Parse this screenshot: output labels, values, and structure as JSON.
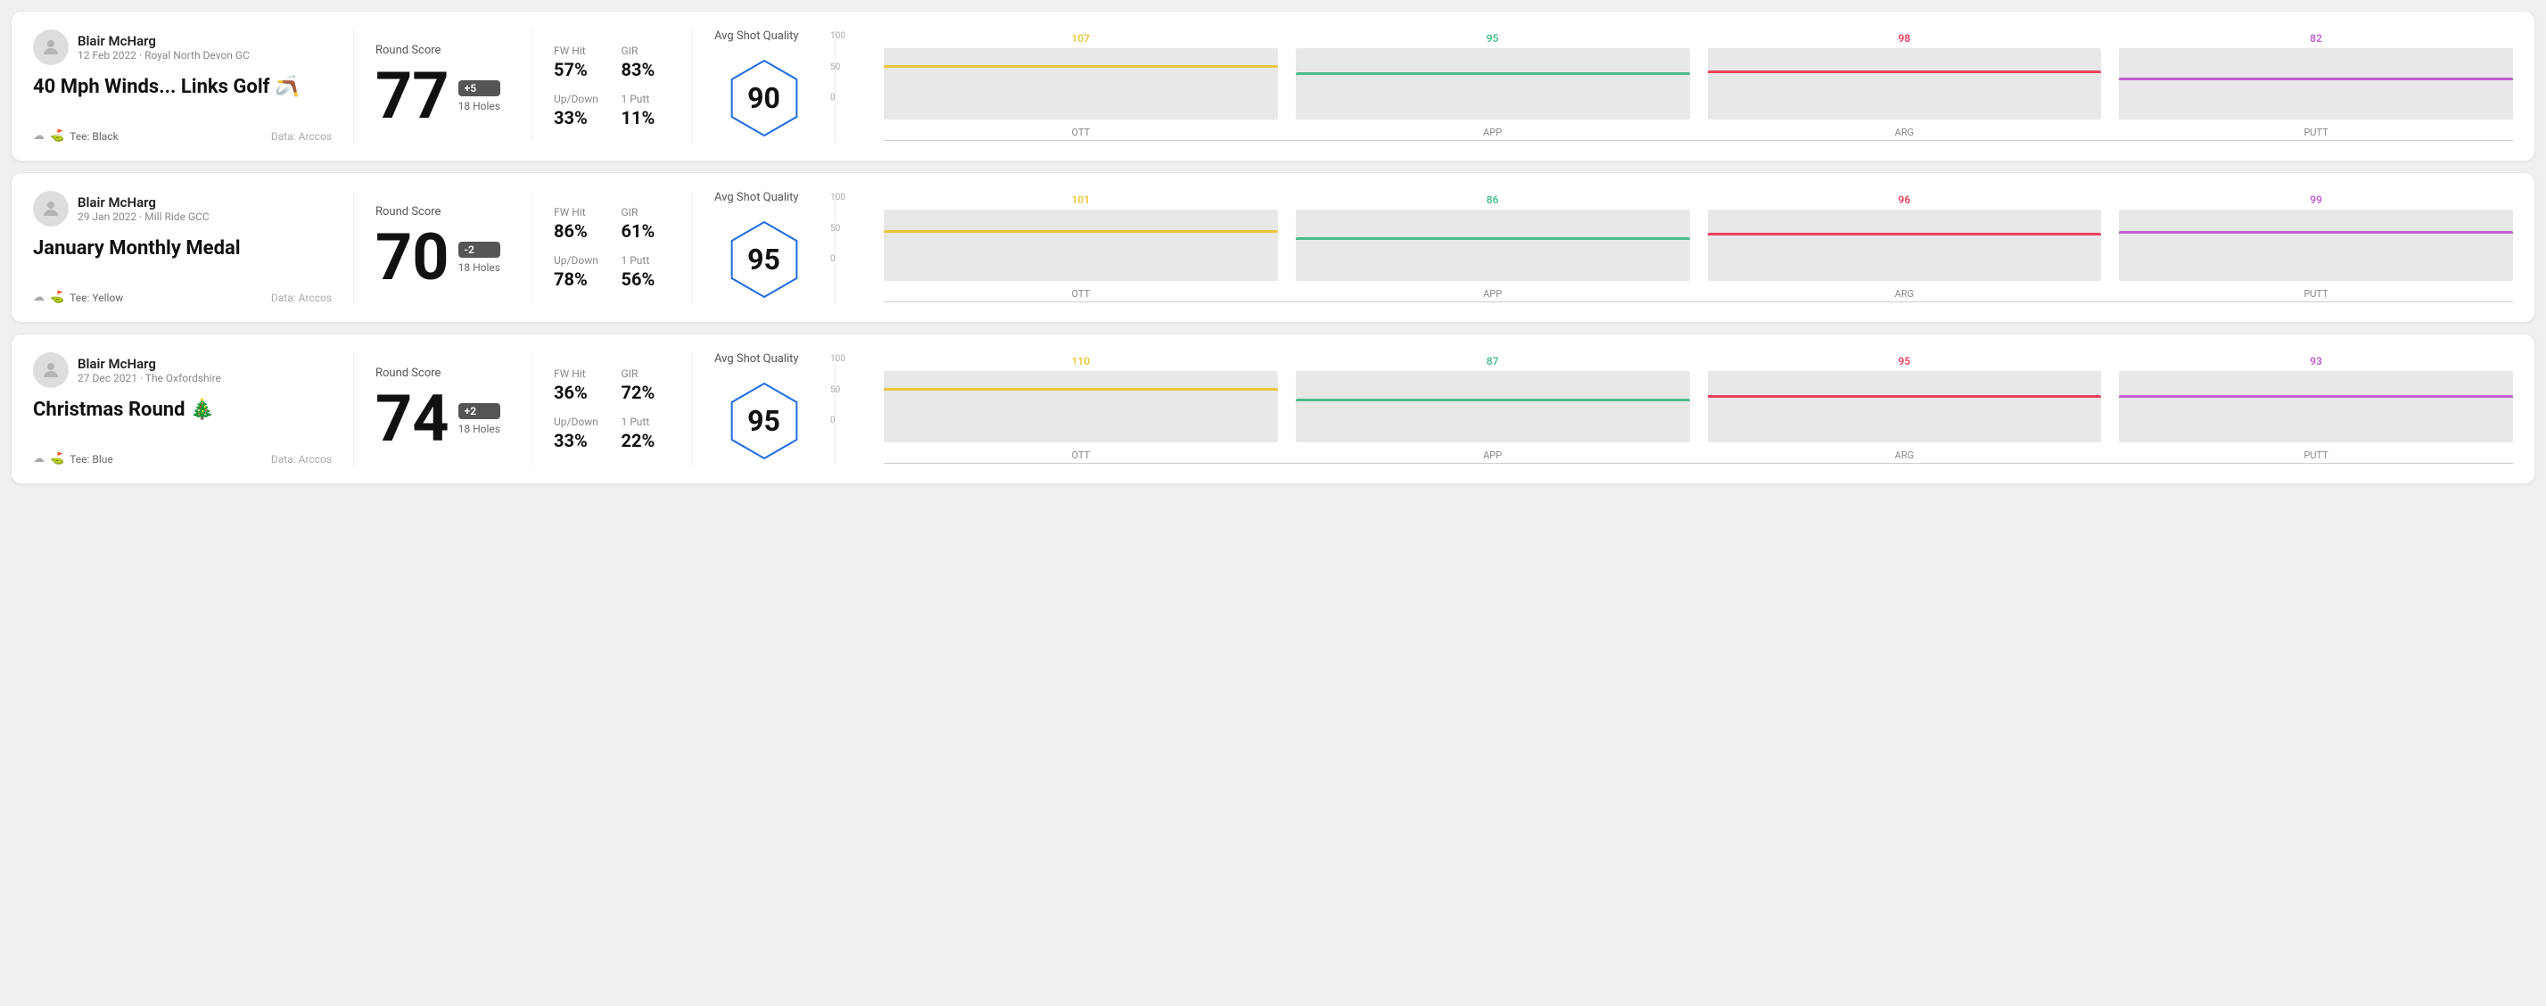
{
  "cards": [
    {
      "id": "card-1",
      "user": {
        "name": "Blair McHarg",
        "meta": "12 Feb 2022 · Royal North Devon GC"
      },
      "title": "40 Mph Winds... Links Golf 🪃",
      "tee": "Black",
      "data_source": "Data: Arccos",
      "round_score_label": "Round Score",
      "score": "77",
      "badge": "+5",
      "holes": "18 Holes",
      "stats": [
        {
          "label": "FW Hit",
          "value": "57%"
        },
        {
          "label": "GIR",
          "value": "83%"
        },
        {
          "label": "Up/Down",
          "value": "33%"
        },
        {
          "label": "1 Putt",
          "value": "11%"
        }
      ],
      "avg_shot_label": "Avg Shot Quality",
      "quality_score": "90",
      "bars": [
        {
          "label": "OTT",
          "value": 107,
          "color": "#e8c840",
          "pct": 72
        },
        {
          "label": "APP",
          "value": 95,
          "color": "#4cbe8c",
          "pct": 63
        },
        {
          "label": "ARG",
          "value": 98,
          "color": "#e84060",
          "pct": 65
        },
        {
          "label": "PUTT",
          "value": 82,
          "color": "#c060d0",
          "pct": 55
        }
      ]
    },
    {
      "id": "card-2",
      "user": {
        "name": "Blair McHarg",
        "meta": "29 Jan 2022 · Mill Ride GCC"
      },
      "title": "January Monthly Medal",
      "tee": "Yellow",
      "data_source": "Data: Arccos",
      "round_score_label": "Round Score",
      "score": "70",
      "badge": "-2",
      "holes": "18 Holes",
      "stats": [
        {
          "label": "FW Hit",
          "value": "86%"
        },
        {
          "label": "GIR",
          "value": "61%"
        },
        {
          "label": "Up/Down",
          "value": "78%"
        },
        {
          "label": "1 Putt",
          "value": "56%"
        }
      ],
      "avg_shot_label": "Avg Shot Quality",
      "quality_score": "95",
      "bars": [
        {
          "label": "OTT",
          "value": 101,
          "color": "#e8c840",
          "pct": 67
        },
        {
          "label": "APP",
          "value": 86,
          "color": "#4cbe8c",
          "pct": 57
        },
        {
          "label": "ARG",
          "value": 96,
          "color": "#e84060",
          "pct": 64
        },
        {
          "label": "PUTT",
          "value": 99,
          "color": "#c060d0",
          "pct": 66
        }
      ]
    },
    {
      "id": "card-3",
      "user": {
        "name": "Blair McHarg",
        "meta": "27 Dec 2021 · The Oxfordshire"
      },
      "title": "Christmas Round 🎄",
      "tee": "Blue",
      "data_source": "Data: Arccos",
      "round_score_label": "Round Score",
      "score": "74",
      "badge": "+2",
      "holes": "18 Holes",
      "stats": [
        {
          "label": "FW Hit",
          "value": "36%"
        },
        {
          "label": "GIR",
          "value": "72%"
        },
        {
          "label": "Up/Down",
          "value": "33%"
        },
        {
          "label": "1 Putt",
          "value": "22%"
        }
      ],
      "avg_shot_label": "Avg Shot Quality",
      "quality_score": "95",
      "bars": [
        {
          "label": "OTT",
          "value": 110,
          "color": "#e8c840",
          "pct": 73
        },
        {
          "label": "APP",
          "value": 87,
          "color": "#4cbe8c",
          "pct": 58
        },
        {
          "label": "ARG",
          "value": 95,
          "color": "#e84060",
          "pct": 63
        },
        {
          "label": "PUTT",
          "value": 93,
          "color": "#c060d0",
          "pct": 62
        }
      ]
    }
  ],
  "labels": {
    "data_label": "Data: Arccos",
    "tee_prefix": "Tee:",
    "y_axis_100": "100",
    "y_axis_50": "50",
    "y_axis_0": "0"
  }
}
